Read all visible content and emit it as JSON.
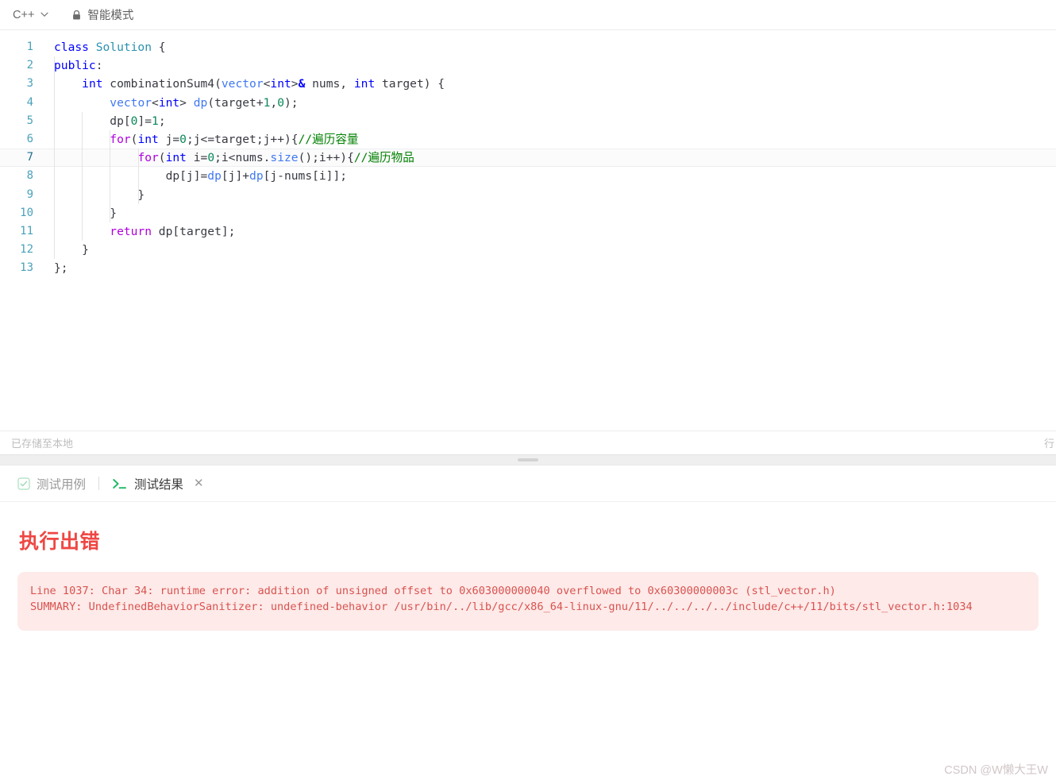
{
  "topbar": {
    "language": "C++",
    "chevron_icon": "chevron-down-icon",
    "lock_icon": "lock-icon",
    "mode_label": "智能模式"
  },
  "editor": {
    "active_line": 7,
    "lines": [
      {
        "n": "1",
        "tokens": [
          {
            "t": "class ",
            "c": "kw"
          },
          {
            "t": "Solution",
            "c": "cls"
          },
          {
            "t": " {",
            "c": "op"
          }
        ]
      },
      {
        "n": "2",
        "tokens": [
          {
            "t": "public",
            "c": "kw"
          },
          {
            "t": ":",
            "c": "op"
          }
        ]
      },
      {
        "n": "3",
        "tokens": [
          {
            "t": "    ",
            "c": "op"
          },
          {
            "t": "int",
            "c": "kw"
          },
          {
            "t": " combinationSum4(",
            "c": "fn"
          },
          {
            "t": "vector",
            "c": "typ"
          },
          {
            "t": "<",
            "c": "op"
          },
          {
            "t": "int",
            "c": "kw"
          },
          {
            "t": ">",
            "c": "op"
          },
          {
            "t": "&",
            "c": "amp"
          },
          {
            "t": " nums, ",
            "c": "fn"
          },
          {
            "t": "int",
            "c": "kw"
          },
          {
            "t": " target) {",
            "c": "fn"
          }
        ]
      },
      {
        "n": "4",
        "tokens": [
          {
            "t": "        ",
            "c": "op"
          },
          {
            "t": "vector",
            "c": "typ"
          },
          {
            "t": "<",
            "c": "op"
          },
          {
            "t": "int",
            "c": "kw"
          },
          {
            "t": "> ",
            "c": "op"
          },
          {
            "t": "dp",
            "c": "typ"
          },
          {
            "t": "(target+",
            "c": "op"
          },
          {
            "t": "1",
            "c": "num"
          },
          {
            "t": ",",
            "c": "op"
          },
          {
            "t": "0",
            "c": "num"
          },
          {
            "t": ");",
            "c": "op"
          }
        ]
      },
      {
        "n": "5",
        "tokens": [
          {
            "t": "        dp[",
            "c": "op"
          },
          {
            "t": "0",
            "c": "num"
          },
          {
            "t": "]=",
            "c": "op"
          },
          {
            "t": "1",
            "c": "num"
          },
          {
            "t": ";",
            "c": "op"
          }
        ]
      },
      {
        "n": "6",
        "tokens": [
          {
            "t": "        ",
            "c": "op"
          },
          {
            "t": "for",
            "c": "kwp"
          },
          {
            "t": "(",
            "c": "op"
          },
          {
            "t": "int",
            "c": "kw"
          },
          {
            "t": " j=",
            "c": "op"
          },
          {
            "t": "0",
            "c": "num"
          },
          {
            "t": ";j<=target;j++){",
            "c": "op"
          },
          {
            "t": "//遍历容量",
            "c": "cmt"
          }
        ]
      },
      {
        "n": "7",
        "tokens": [
          {
            "t": "            ",
            "c": "op"
          },
          {
            "t": "for",
            "c": "kwp"
          },
          {
            "t": "(",
            "c": "op"
          },
          {
            "t": "int",
            "c": "kw"
          },
          {
            "t": " i=",
            "c": "op"
          },
          {
            "t": "0",
            "c": "num"
          },
          {
            "t": ";i<nums.",
            "c": "op"
          },
          {
            "t": "size",
            "c": "typ"
          },
          {
            "t": "();i++){",
            "c": "op"
          },
          {
            "t": "//遍历物品",
            "c": "cmt"
          }
        ]
      },
      {
        "n": "8",
        "tokens": [
          {
            "t": "                dp[j]=",
            "c": "op"
          },
          {
            "t": "dp",
            "c": "typ"
          },
          {
            "t": "[j]+",
            "c": "op"
          },
          {
            "t": "dp",
            "c": "typ"
          },
          {
            "t": "[j-nums[i]];",
            "c": "op"
          }
        ]
      },
      {
        "n": "9",
        "tokens": [
          {
            "t": "            }",
            "c": "op"
          }
        ]
      },
      {
        "n": "10",
        "tokens": [
          {
            "t": "        }",
            "c": "op"
          }
        ]
      },
      {
        "n": "11",
        "tokens": [
          {
            "t": "        ",
            "c": "op"
          },
          {
            "t": "return",
            "c": "kwp"
          },
          {
            "t": " dp[target];",
            "c": "op"
          }
        ]
      },
      {
        "n": "12",
        "tokens": [
          {
            "t": "    }",
            "c": "op"
          }
        ]
      },
      {
        "n": "13",
        "tokens": [
          {
            "t": "};",
            "c": "op"
          }
        ]
      }
    ]
  },
  "savebar": {
    "saved_label": "已存储至本地",
    "line_label": "行"
  },
  "splitter": {
    "handle_icon": "drag-handle-icon"
  },
  "tabs": [
    {
      "id": "testcase",
      "label": "测试用例",
      "icon": "checkbox-icon",
      "active": false
    },
    {
      "id": "testresult",
      "label": "测试结果",
      "icon": "terminal-icon",
      "active": true,
      "closable": true,
      "close_icon": "close-icon"
    }
  ],
  "result": {
    "title": "执行出错",
    "message": "Line 1037: Char 34: runtime error: addition of unsigned offset to 0x603000000040 overflowed to 0x60300000003c (stl_vector.h)\nSUMMARY: UndefinedBehaviorSanitizer: undefined-behavior /usr/bin/../lib/gcc/x86_64-linux-gnu/11/../../../../include/c++/11/bits/stl_vector.h:1034"
  },
  "watermark": "CSDN @W懒大王W",
  "colors": {
    "error_red": "#ef4743",
    "error_bg": "#fdeae9",
    "error_text": "#d9534f",
    "accent_green": "#2fbf6b",
    "linenum": "#2b91af"
  }
}
